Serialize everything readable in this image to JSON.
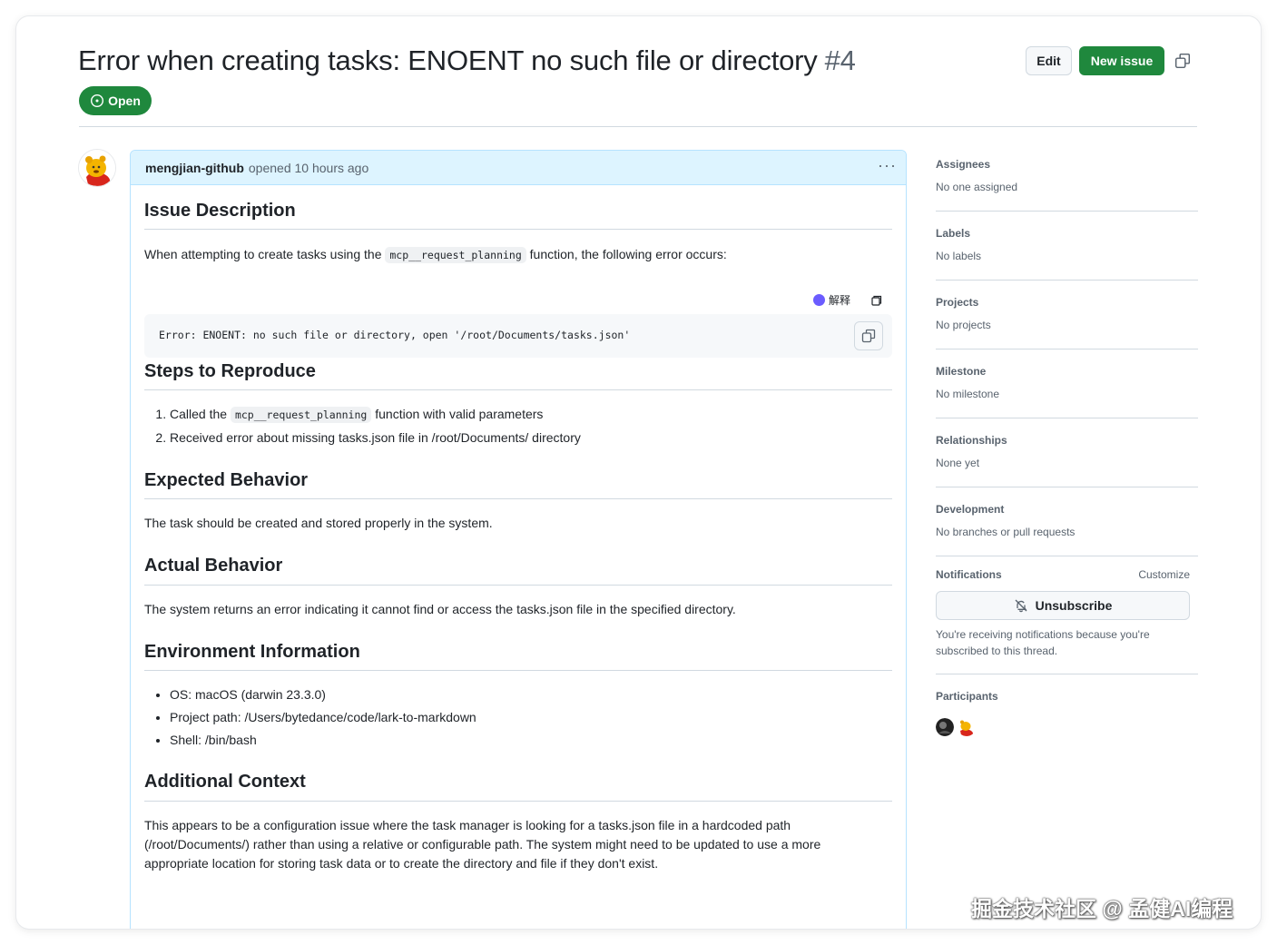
{
  "issue": {
    "title": "Error when creating tasks: ENOENT no such file or directory",
    "number": "#4",
    "state": "Open"
  },
  "header": {
    "edit_label": "Edit",
    "new_issue_label": "New issue"
  },
  "comment": {
    "author": "mengjian-github",
    "meta": "opened 10 hours ago",
    "more": "···"
  },
  "content": {
    "h_description": "Issue Description",
    "desc_before": "When attempting to create tasks using the ",
    "desc_code": "mcp__request_planning",
    "desc_after": " function, the following error occurs:",
    "translate_label": "解释",
    "error_code": "Error: ENOENT: no such file or directory, open '/root/Documents/tasks.json'",
    "h_steps": "Steps to Reproduce",
    "step1_before": "Called the ",
    "step1_code": "mcp__request_planning",
    "step1_after": " function with valid parameters",
    "step2": "Received error about missing tasks.json file in /root/Documents/ directory",
    "h_expected": "Expected Behavior",
    "expected": "The task should be created and stored properly in the system.",
    "h_actual": "Actual Behavior",
    "actual": "The system returns an error indicating it cannot find or access the tasks.json file in the specified directory.",
    "h_env": "Environment Information",
    "env": [
      "OS: macOS (darwin 23.3.0)",
      "Project path: /Users/bytedance/code/lark-to-markdown",
      "Shell: /bin/bash"
    ],
    "h_context": "Additional Context",
    "context_lines": [
      "This appears to be a configuration issue where the task manager is looking for a tasks.json file in a hardcoded path",
      "(/root/Documents/) rather than using a relative or configurable path. The system might need to be updated to use a more",
      "appropriate location for storing task data or to create the directory and file if they don't exist."
    ]
  },
  "sidebar": {
    "assignees": {
      "label": "Assignees",
      "value": "No one assigned"
    },
    "labels": {
      "label": "Labels",
      "value": "No labels"
    },
    "projects": {
      "label": "Projects",
      "value": "No projects"
    },
    "milestone": {
      "label": "Milestone",
      "value": "No milestone"
    },
    "relationships": {
      "label": "Relationships",
      "value": "None yet"
    },
    "development": {
      "label": "Development",
      "value": "No branches or pull requests"
    },
    "notifications": {
      "label": "Notifications",
      "customize": "Customize",
      "unsubscribe": "Unsubscribe",
      "note_line1": "You're receiving notifications because you're",
      "note_line2": "subscribed to this thread."
    },
    "participants": {
      "label": "Participants"
    }
  },
  "watermark": "掘金技术社区 @ 孟健AI编程",
  "colors": {
    "accent_green": "#1f883d",
    "header_blue": "#ddf4ff",
    "border_blue": "#b6e3ff"
  }
}
